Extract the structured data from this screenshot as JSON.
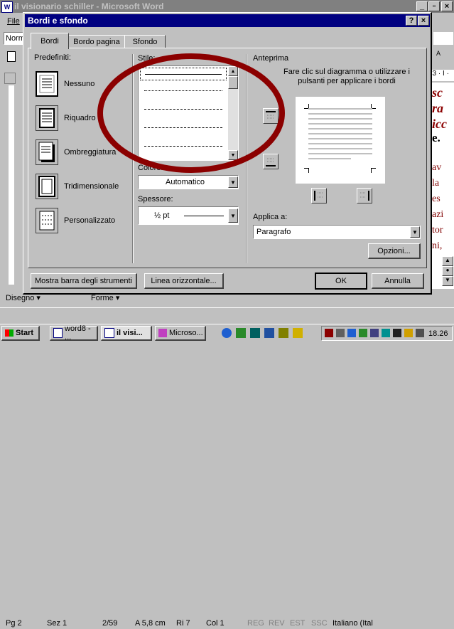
{
  "app": {
    "title": "il visionario schiller - Microsoft Word",
    "menu_first": "File"
  },
  "toolbar": {
    "style_box": "Norm",
    "zoom": "13"
  },
  "dialog": {
    "title": "Bordi e sfondo",
    "help": "?",
    "close": "×",
    "tabs": [
      "Bordi",
      "Bordo pagina",
      "Sfondo"
    ],
    "predefiniti_label": "Predefiniti:",
    "presets": [
      "Nessuno",
      "Riquadro",
      "Ombreggiatura",
      "Tridimensionale",
      "Personalizzato"
    ],
    "stile_label": "Stile:",
    "colore_label": "Colore:",
    "colore_value": "Automatico",
    "spessore_label": "Spessore:",
    "spessore_value": "½ pt",
    "anteprima_label": "Anteprima",
    "anteprima_hint": "Fare clic sul diagramma o utilizzare i pulsanti per applicare i bordi",
    "applica_label": "Applica a:",
    "applica_value": "Paragrafo",
    "opzioni": "Opzioni...",
    "mostra_barra": "Mostra barra degli strumenti",
    "linea": "Linea orizzontale...",
    "ok": "OK",
    "annulla": "Annulla"
  },
  "document_text": [
    "sc",
    "ra",
    "icc",
    "e.",
    "av",
    "la",
    "es",
    "azi",
    "tor",
    "ni,"
  ],
  "draw_toolbar": {
    "disegno": "Disegno",
    "forme": "Forme"
  },
  "status": {
    "pg": "Pg 2",
    "sez": "Sez 1",
    "pages": "2/59",
    "pos": "A 5,8 cm",
    "ri": "Ri 7",
    "col": "Col 1",
    "reg": "REG",
    "rev": "REV",
    "est": "EST",
    "ssc": "SSC",
    "lang": "Italiano (Ital"
  },
  "taskbar": {
    "start": "Start",
    "tasks": [
      "word8 - ...",
      "il visi...",
      "Microso..."
    ],
    "clock": "18.26"
  },
  "colors": {
    "titlebar": "#000080",
    "annotation_circle": "#8b0000",
    "doc_text": "#800000"
  }
}
